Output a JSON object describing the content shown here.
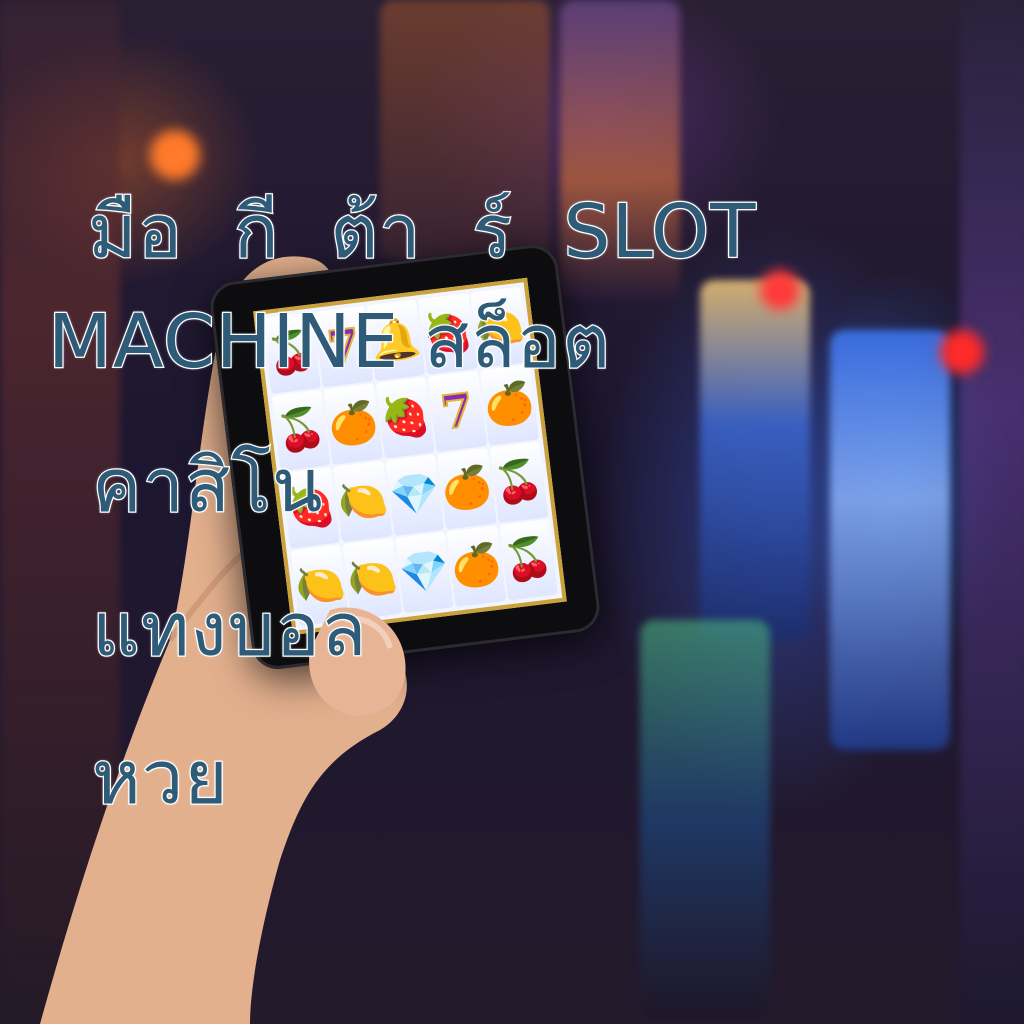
{
  "overlay_text": {
    "line1": "มือ กี ต้า ร์ SLOT",
    "line2": "MACHINE สล็อต",
    "line3": "คาสิโน",
    "line4": "แทงบอล",
    "line5": "หวย"
  },
  "slot_screen": {
    "rows": [
      [
        "🍒",
        "7",
        "🔔",
        "🍓",
        "🍋"
      ],
      [
        "🍒",
        "🍊",
        "🍓",
        "7",
        "🍊"
      ],
      [
        "🍓",
        "🍋",
        "💎",
        "🍊",
        "🍒"
      ],
      [
        "🍋",
        "🍋",
        "💎",
        "🍊",
        "🍒"
      ]
    ]
  },
  "colors": {
    "text_fill": "#2e5b78",
    "text_outline": "#ffffff",
    "reel_frame": "#c9a23a"
  }
}
